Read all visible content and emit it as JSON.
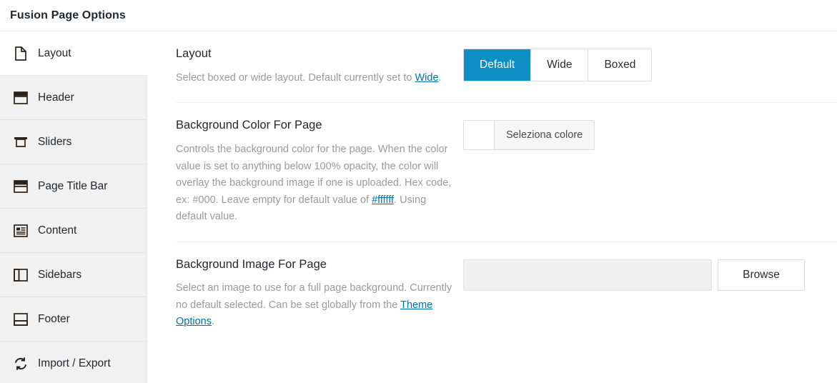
{
  "header": {
    "title": "Fusion Page Options"
  },
  "sidebar": {
    "items": [
      {
        "label": "Layout",
        "icon": "page-icon",
        "active": true
      },
      {
        "label": "Header",
        "icon": "header-icon",
        "active": false
      },
      {
        "label": "Sliders",
        "icon": "slider-icon",
        "active": false
      },
      {
        "label": "Page Title Bar",
        "icon": "title-bar-icon",
        "active": false
      },
      {
        "label": "Content",
        "icon": "content-icon",
        "active": false
      },
      {
        "label": "Sidebars",
        "icon": "sidebars-icon",
        "active": false
      },
      {
        "label": "Footer",
        "icon": "footer-icon",
        "active": false
      },
      {
        "label": "Import / Export",
        "icon": "refresh-icon",
        "active": false
      }
    ]
  },
  "main": {
    "sections": [
      {
        "label": "Layout",
        "help_parts": [
          {
            "text": "Select boxed or wide layout. Default currently set to ",
            "link": false
          },
          {
            "text": "Wide",
            "link": true
          },
          {
            "text": ".",
            "link": false
          }
        ],
        "control": "button-group",
        "buttons": [
          {
            "label": "Default",
            "active": true
          },
          {
            "label": "Wide",
            "active": false
          },
          {
            "label": "Boxed",
            "active": false
          }
        ]
      },
      {
        "label": "Background Color For Page",
        "help_parts": [
          {
            "text": "Controls the background color for the page. When the color value is set to anything below 100% opacity, the color will overlay the background image if one is uploaded. Hex code, ex: #000. Leave empty for default value of ",
            "link": false
          },
          {
            "text": "#ffffff",
            "link": true
          },
          {
            "text": ". Using default value.",
            "link": false
          }
        ],
        "control": "color-picker",
        "color_picker": {
          "swatch_color": "#ffffff",
          "label": "Seleziona colore"
        }
      },
      {
        "label": "Background Image For Page",
        "help_parts": [
          {
            "text": "Select an image to use for a full page background. Currently no default selected. Can be set globally from the ",
            "link": false
          },
          {
            "text": "Theme Options",
            "link": true
          },
          {
            "text": ".",
            "link": false
          }
        ],
        "control": "upload",
        "upload": {
          "value": "",
          "placeholder": "",
          "browse_label": "Browse"
        }
      }
    ]
  },
  "colors": {
    "accent": "#0d8ec4",
    "link": "#0073aa",
    "sidebar_bg": "#f1f1f1",
    "text": "#23282d",
    "muted_text": "#9a9a9a"
  }
}
